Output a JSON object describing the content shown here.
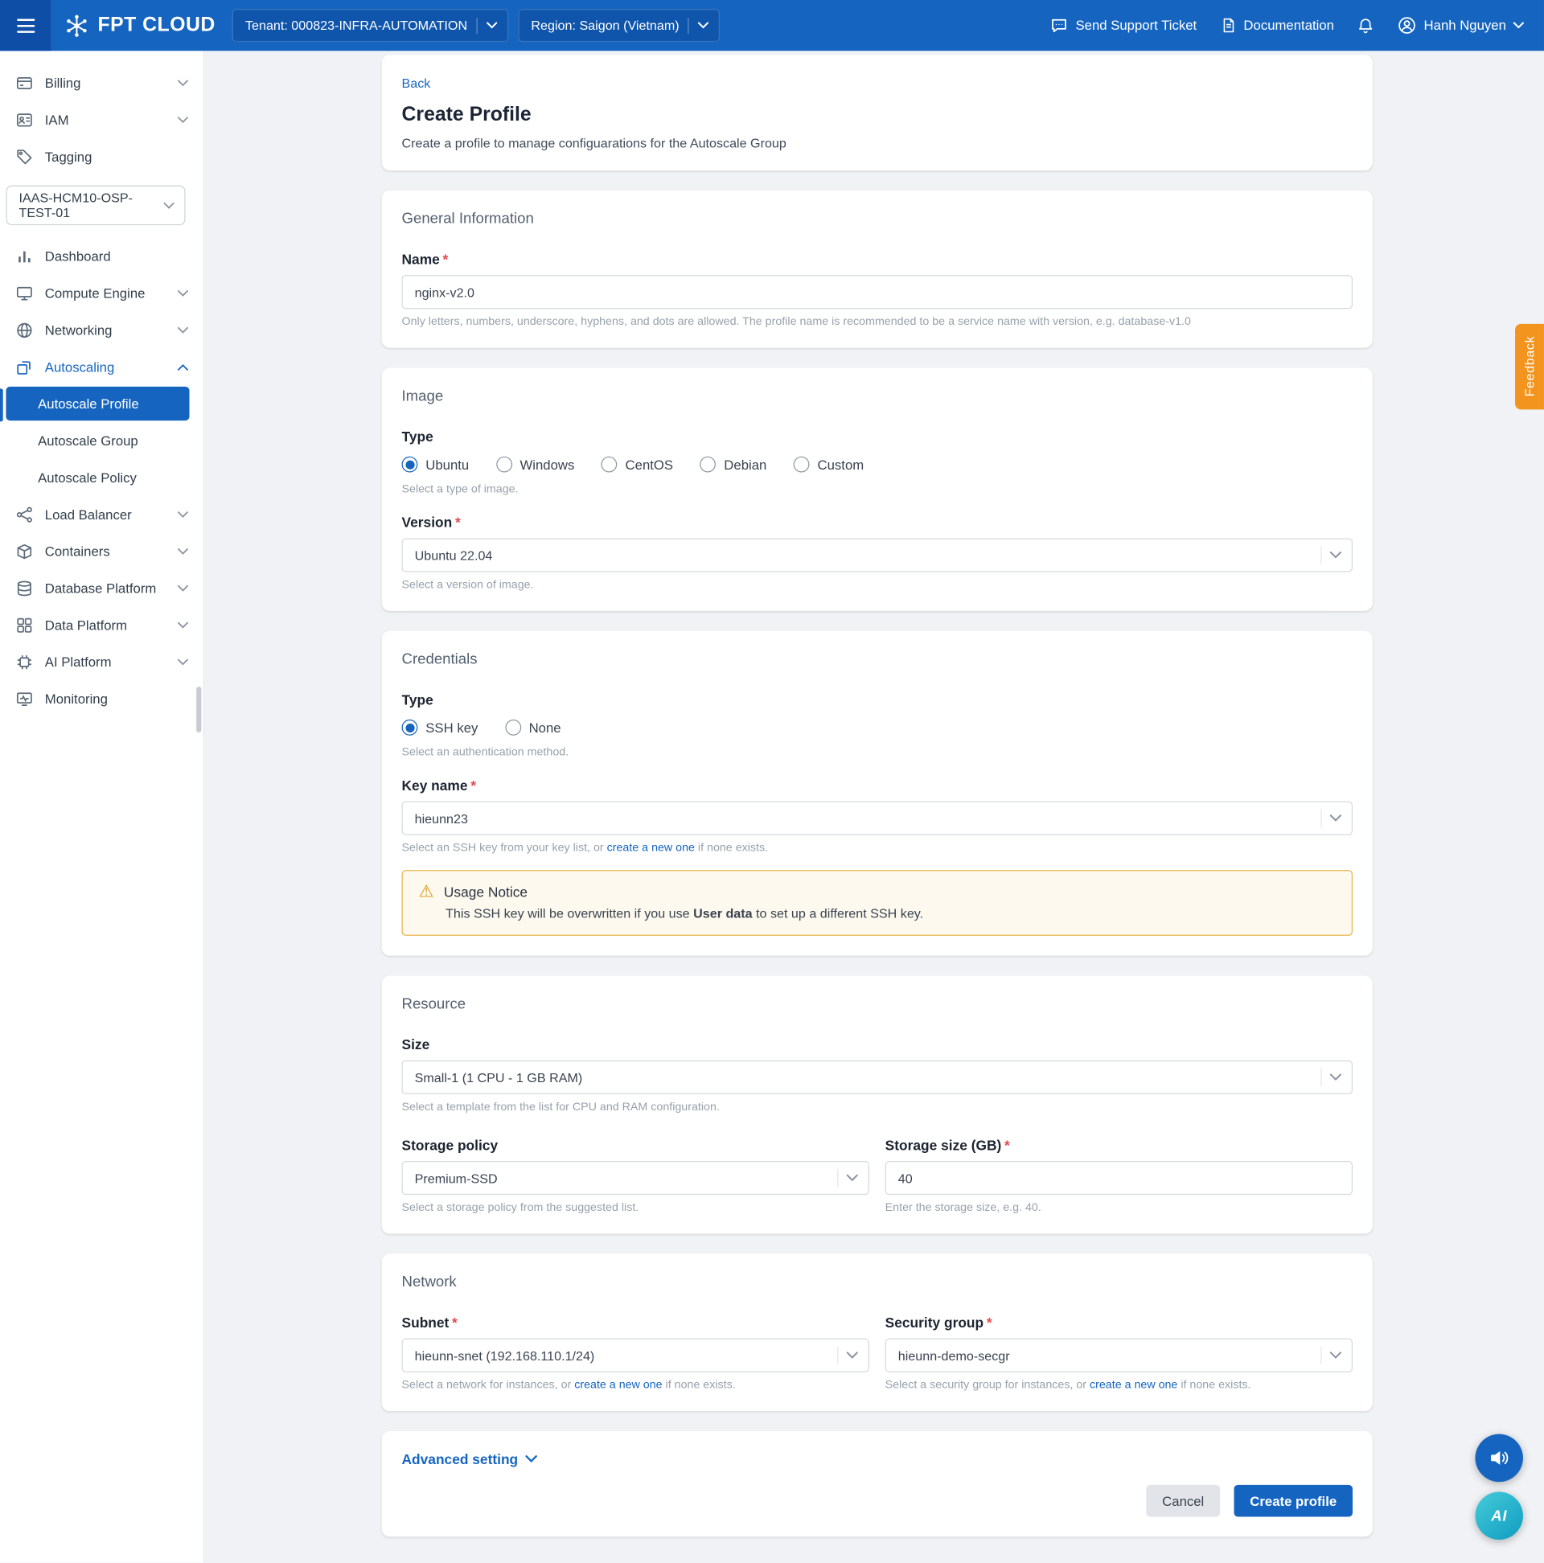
{
  "ui": {
    "required_mark": "*"
  },
  "colors": {
    "primary": "#1565c0",
    "warning_border": "#eab54e",
    "feedback_tab": "#f3941e",
    "active_item": "#1565c0"
  },
  "header": {
    "logo_text": "FPT CLOUD",
    "tenant": "Tenant: 000823-INFRA-AUTOMATION",
    "region": "Region: Saigon (Vietnam)",
    "support": "Send Support Ticket",
    "documentation": "Documentation",
    "user": "Hanh Nguyen"
  },
  "sidebar": {
    "account_items": [
      {
        "label": "Billing"
      },
      {
        "label": "IAM"
      },
      {
        "label": "Tagging"
      }
    ],
    "project_select": "IAAS-HCM10-OSP-TEST-01",
    "menu_items": [
      {
        "label": "Dashboard"
      },
      {
        "label": "Compute Engine"
      },
      {
        "label": "Networking"
      },
      {
        "label": "Autoscaling"
      },
      {
        "label": "Load Balancer"
      },
      {
        "label": "Containers"
      },
      {
        "label": "Database Platform"
      },
      {
        "label": "Data Platform"
      },
      {
        "label": "AI Platform"
      },
      {
        "label": "Monitoring"
      }
    ],
    "autoscaling_children": [
      {
        "label": "Autoscale Profile",
        "active": true
      },
      {
        "label": "Autoscale Group",
        "active": false
      },
      {
        "label": "Autoscale Policy",
        "active": false
      }
    ]
  },
  "page": {
    "back": "Back",
    "title": "Create Profile",
    "subtitle": "Create a profile to manage configuarations for the Autoscale Group"
  },
  "general": {
    "title": "General Information",
    "name": {
      "label": "Name",
      "value": "nginx-v2.0",
      "help": "Only letters, numbers, underscore, hyphens, and dots are allowed. The profile name is recommended to be a service name with version, e.g. database-v1.0"
    }
  },
  "image": {
    "title": "Image",
    "type_label": "Type",
    "type_options": [
      {
        "label": "Ubuntu",
        "selected": true
      },
      {
        "label": "Windows",
        "selected": false
      },
      {
        "label": "CentOS",
        "selected": false
      },
      {
        "label": "Debian",
        "selected": false
      },
      {
        "label": "Custom",
        "selected": false
      }
    ],
    "type_help": "Select a type of image.",
    "version": {
      "label": "Version",
      "value": "Ubuntu 22.04",
      "help": "Select a version of image."
    }
  },
  "credentials": {
    "title": "Credentials",
    "type_label": "Type",
    "type_options": [
      {
        "label": "SSH key",
        "selected": true
      },
      {
        "label": "None",
        "selected": false
      }
    ],
    "type_help": "Select an authentication method.",
    "key_name": {
      "label": "Key name",
      "value": "hieunn23",
      "help_prefix": "Select an SSH key from your key list, or ",
      "help_link": "create a new one",
      "help_suffix": " if none exists."
    },
    "notice": {
      "title": "Usage Notice",
      "text_prefix": "This SSH key will be overwritten if you use ",
      "text_bold": "User data",
      "text_suffix": " to set up a different SSH key."
    }
  },
  "resource": {
    "title": "Resource",
    "size": {
      "label": "Size",
      "value": "Small-1 (1 CPU - 1 GB RAM)",
      "help": "Select a template from the list for CPU and RAM configuration."
    },
    "storage_policy": {
      "label": "Storage policy",
      "value": "Premium-SSD",
      "help": "Select a storage policy from the suggested list."
    },
    "storage_size": {
      "label": "Storage size (GB)",
      "value": "40",
      "help": "Enter the storage size, e.g. 40."
    }
  },
  "network": {
    "title": "Network",
    "subnet": {
      "label": "Subnet",
      "value": "hieunn-snet (192.168.110.1/24)",
      "help_prefix": "Select a network for instances, or ",
      "help_link": "create a new one",
      "help_suffix": " if none exists."
    },
    "security_group": {
      "label": "Security group",
      "value": "hieunn-demo-secgr",
      "help_prefix": "Select a security group for instances, or ",
      "help_link": "create a new one",
      "help_suffix": " if none exists."
    }
  },
  "footer": {
    "advanced": "Advanced setting",
    "cancel": "Cancel",
    "create": "Create profile"
  },
  "floating": {
    "feedback": "Feedback",
    "ai_label": "AI"
  }
}
